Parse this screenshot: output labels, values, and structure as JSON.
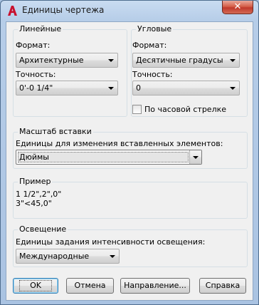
{
  "window": {
    "title": "Единицы чертежа",
    "close_glyph": "✕"
  },
  "linear": {
    "group_title": "Линейные",
    "format_label": "Формат:",
    "format_value": "Архитектурные",
    "precision_label": "Точность:",
    "precision_value": "0'-0 1/4\""
  },
  "angular": {
    "group_title": "Угловые",
    "format_label": "Формат:",
    "format_value": "Десятичные градусы",
    "precision_label": "Точность:",
    "precision_value": "0",
    "clockwise_label": "По часовой стрелке",
    "clockwise_checked": false
  },
  "insert_scale": {
    "group_title": "Масштаб вставки",
    "units_label": "Единицы для изменения вставленных элементов:",
    "units_value": "Дюймы"
  },
  "sample": {
    "group_title": "Пример",
    "line1": "1 1/2\",2\",0\"",
    "line2": "3\"<45,0\""
  },
  "lighting": {
    "group_title": "Освещение",
    "units_label": "Единицы задания интенсивности освещения:",
    "units_value": "Международные"
  },
  "buttons": {
    "ok": "OK",
    "cancel": "Отмена",
    "direction": "Направление...",
    "help": "Справка"
  },
  "colors": {
    "title_bar": "#b6cde8",
    "close_button": "#c0392b",
    "app_icon": "#c8102e"
  }
}
